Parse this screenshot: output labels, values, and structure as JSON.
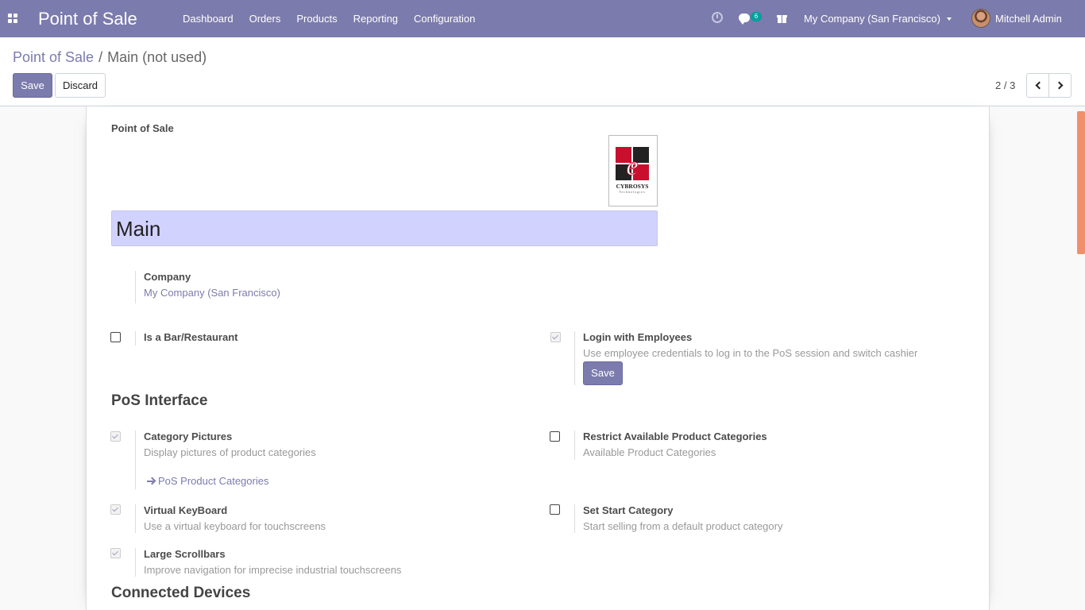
{
  "navbar": {
    "brand": "Point of Sale",
    "menu": [
      "Dashboard",
      "Orders",
      "Products",
      "Reporting",
      "Configuration"
    ],
    "chat_badge": "6",
    "company": "My Company (San Francisco)",
    "user": "Mitchell Admin",
    "bg_color": "#7c7bad"
  },
  "breadcrumb": {
    "parent": "Point of Sale",
    "separator": "/",
    "current": "Main (not used)"
  },
  "toolbar": {
    "save_label": "Save",
    "discard_label": "Discard",
    "pager": "2 / 3"
  },
  "form": {
    "section_label": "Point of Sale",
    "name_value": "Main",
    "logo_text": "CYBROSYS",
    "logo_sub": "Technologies",
    "company": {
      "label": "Company",
      "value": "My Company (San Francisco)"
    },
    "bar_restaurant": {
      "label": "Is a Bar/Restaurant",
      "checked": false
    },
    "login_employees": {
      "label": "Login with Employees",
      "desc": "Use employee credentials to log in to the PoS session and switch cashier",
      "checked": true,
      "save_label": "Save"
    },
    "pos_interface_title": "PoS Interface",
    "category_pictures": {
      "label": "Category Pictures",
      "desc": "Display pictures of product categories",
      "checked": true,
      "link": "PoS Product Categories"
    },
    "restrict_categories": {
      "label": "Restrict Available Product Categories",
      "desc": "Available Product Categories",
      "checked": false
    },
    "virtual_keyboard": {
      "label": "Virtual KeyBoard",
      "desc": "Use a virtual keyboard for touchscreens",
      "checked": true
    },
    "start_category": {
      "label": "Set Start Category",
      "desc": "Start selling from a default product category",
      "checked": false
    },
    "large_scrollbars": {
      "label": "Large Scrollbars",
      "desc": "Improve navigation for imprecise industrial touchscreens",
      "checked": true
    },
    "connected_devices_title": "Connected Devices"
  }
}
